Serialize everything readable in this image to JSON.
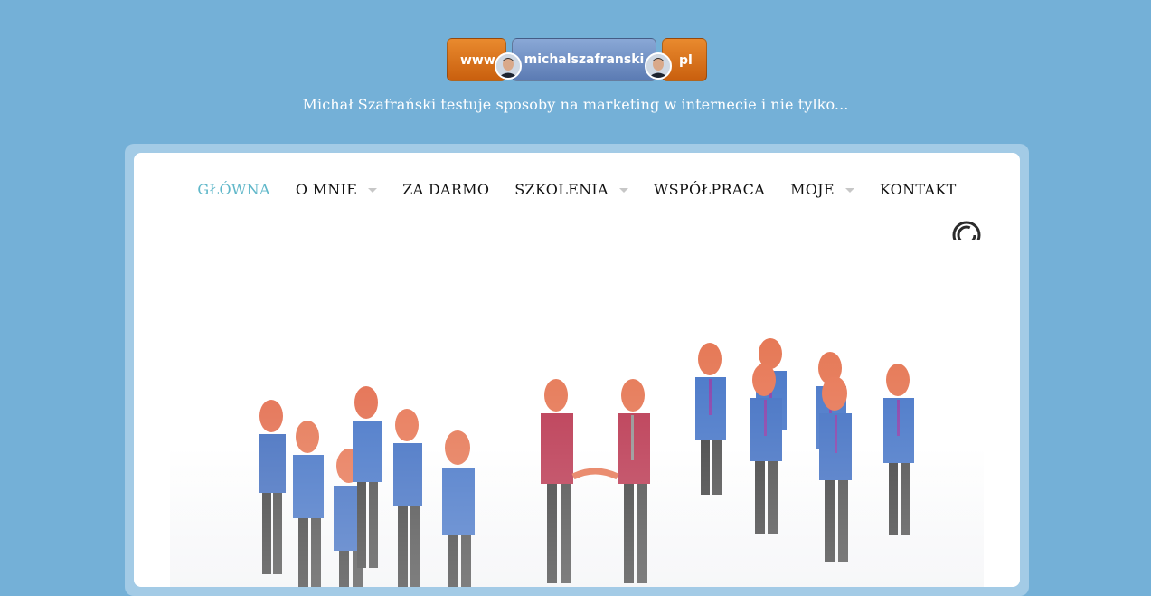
{
  "logo": {
    "www": "www",
    "name": "michalszafranski",
    "tld": "pl"
  },
  "tagline": "Michał Szafrański testuje sposoby na marketing w internecie i nie tylko...",
  "nav": {
    "items": [
      {
        "label": "GŁÓWNA",
        "active": true,
        "has_submenu": false
      },
      {
        "label": "O MNIE",
        "active": false,
        "has_submenu": true
      },
      {
        "label": "ZA DARMO",
        "active": false,
        "has_submenu": false
      },
      {
        "label": "SZKOLENIA",
        "active": false,
        "has_submenu": true
      },
      {
        "label": "WSPÓŁPRACA",
        "active": false,
        "has_submenu": false
      },
      {
        "label": "MOJE",
        "active": false,
        "has_submenu": true
      },
      {
        "label": "KONTAKT",
        "active": false,
        "has_submenu": false
      }
    ]
  },
  "colors": {
    "background": "#74b0d7",
    "nav_active": "#5fb7c9",
    "logo_orange": "#d9731d",
    "logo_blue": "#6f8fc6"
  },
  "icons": {
    "loader": "loading-spinner-icon",
    "caret": "caret-down-icon"
  }
}
